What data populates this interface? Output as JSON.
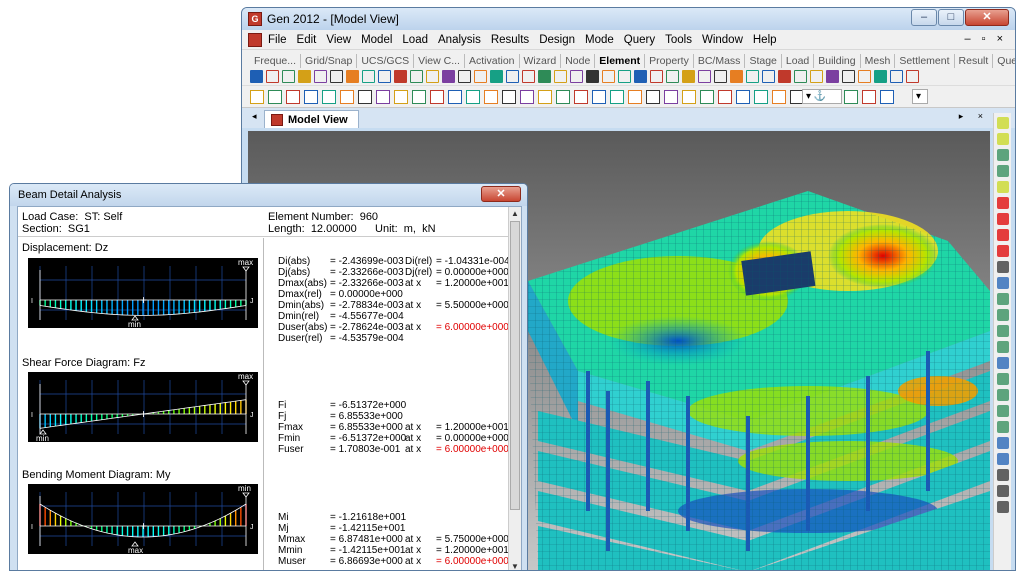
{
  "main": {
    "title": "Gen 2012 - [Model View]",
    "menu": [
      "File",
      "Edit",
      "View",
      "Model",
      "Load",
      "Analysis",
      "Results",
      "Design",
      "Mode",
      "Query",
      "Tools",
      "Window",
      "Help"
    ],
    "tabs_left": [
      "Freque...",
      "Grid/Snap",
      "UCS/GCS",
      "View C...",
      "Activation"
    ],
    "tabs_right": [
      "Wizard",
      "Node",
      "Element",
      "Property",
      "BC/Mass",
      "Stage",
      "Load",
      "Building",
      "Mesh",
      "Settlement",
      "Result",
      "Query"
    ],
    "active_tab": "Element",
    "doc_tab": "Model View"
  },
  "dialog": {
    "title": "Beam Detail Analysis",
    "load_case": "Load Case:  ST: Self",
    "section": "Section:  SG1",
    "element_number": "Element Number:  960",
    "length": "Length:  12.00000      Unit:  m,  kN",
    "sections": [
      {
        "title": "Displacement: Dz",
        "top_marker": "max",
        "bottom_marker": "min",
        "rows": [
          [
            "Di(abs)",
            "= -2.43699e-003",
            "Di(rel)",
            "= -1.04331e-004",
            ""
          ],
          [
            "Dj(abs)",
            "= -2.33266e-003",
            "Dj(rel)",
            "= 0.00000e+000",
            ""
          ],
          [
            "Dmax(abs)",
            "= -2.33266e-003",
            "at x",
            "= 1.20000e+001",
            ""
          ],
          [
            "Dmax(rel)",
            "= 0.00000e+000",
            "",
            "",
            ""
          ],
          [
            "Dmin(abs)",
            "= -2.78834e-003",
            "at x",
            "= 5.50000e+000",
            ""
          ],
          [
            "Dmin(rel)",
            "= -4.55677e-004",
            "",
            "",
            ""
          ],
          [
            "Duser(abs)",
            "= -2.78624e-003",
            "at x",
            "",
            "= 6.00000e+000"
          ],
          [
            "Duser(rel)",
            "= -4.53579e-004",
            "",
            "",
            ""
          ]
        ]
      },
      {
        "title": "Shear Force Diagram: Fz",
        "top_marker": "max",
        "bottom_marker": "min",
        "rows": [
          [
            "Fi",
            "= -6.51372e+000",
            "",
            "",
            ""
          ],
          [
            "Fj",
            "= 6.85533e+000",
            "",
            "",
            ""
          ],
          [
            "Fmax",
            "= 6.85533e+000",
            "at x",
            "= 1.20000e+001",
            ""
          ],
          [
            "Fmin",
            "= -6.51372e+000",
            "at x",
            "= 0.00000e+000",
            ""
          ],
          [
            "Fuser",
            "= 1.70803e-001",
            "at x",
            "",
            "= 6.00000e+000"
          ]
        ]
      },
      {
        "title": "Bending Moment Diagram: My",
        "top_marker": "min",
        "bottom_marker": "max",
        "rows": [
          [
            "Mi",
            "= -1.21618e+001",
            "",
            "",
            ""
          ],
          [
            "Mj",
            "= -1.42115e+001",
            "",
            "",
            ""
          ],
          [
            "Mmax",
            "= 6.87481e+000",
            "at x",
            "= 5.75000e+000",
            ""
          ],
          [
            "Mmin",
            "= -1.42115e+001",
            "at x",
            "= 1.20000e+001",
            ""
          ],
          [
            "Muser",
            "= 6.86693e+000",
            "at x",
            "",
            "= 6.00000e+000"
          ]
        ]
      }
    ]
  }
}
